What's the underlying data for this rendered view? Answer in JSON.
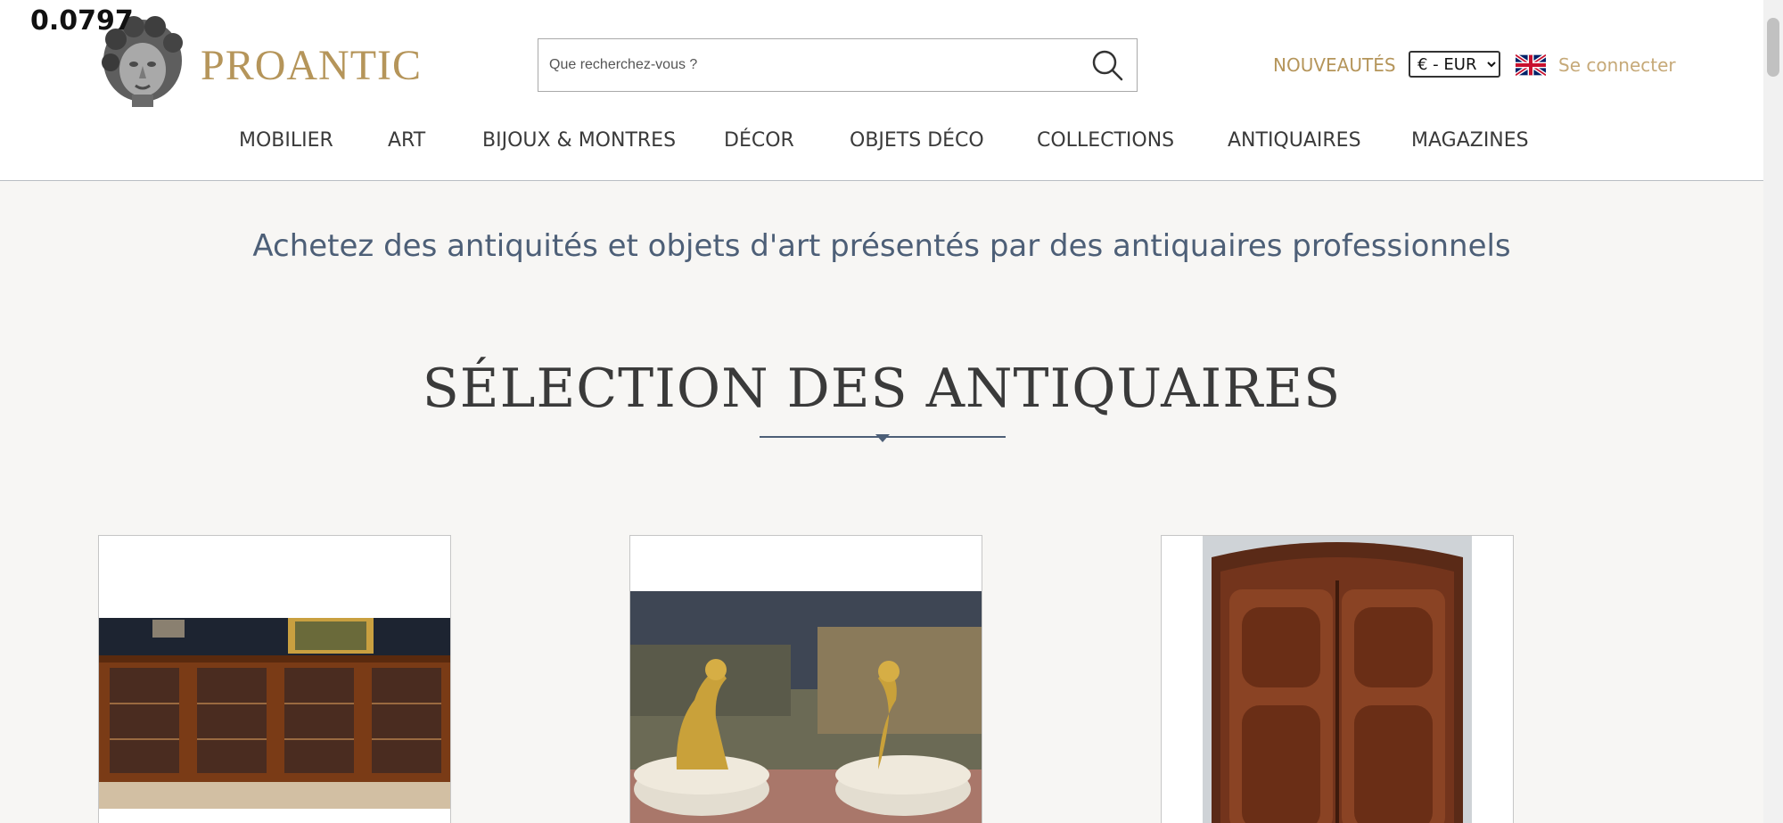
{
  "overlay": {
    "value": "0.0797"
  },
  "header": {
    "brand": "PROANTIC",
    "search_placeholder": "Que recherchez-vous ?",
    "nouveautes": "NOUVEAUTÉS",
    "currency": {
      "selected": "€ - EUR",
      "options": [
        "€ - EUR"
      ]
    },
    "login": "Se connecter"
  },
  "nav": {
    "items": [
      "MOBILIER",
      "ART",
      "BIJOUX & MONTRES",
      "DÉCOR",
      "OBJETS DÉCO",
      "COLLECTIONS",
      "ANTIQUAIRES",
      "MAGAZINES"
    ]
  },
  "main": {
    "tagline": "Achetez des antiquités et objets d'art présentés par des antiquaires professionnels",
    "section_title": "SÉLECTION DES ANTIQUAIRES",
    "products": [
      {
        "image": "bookcase-image"
      },
      {
        "image": "gilt-dogs-image"
      },
      {
        "image": "armoire-image"
      }
    ]
  },
  "colors": {
    "gold": "#b5955a",
    "blue_grey": "#4d5f77",
    "background": "#f7f6f4"
  }
}
